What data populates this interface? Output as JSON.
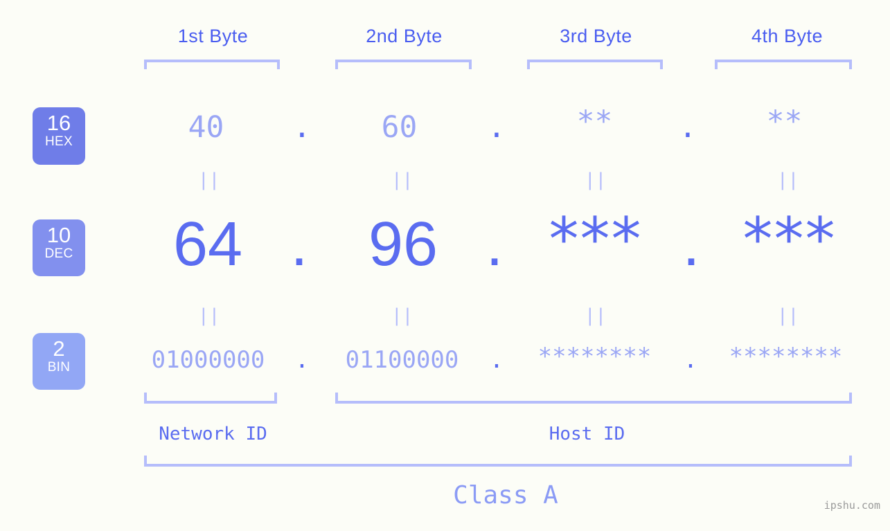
{
  "background_color": "#fcfdf7",
  "accent_colors": {
    "strong_blue": "#5a6cf0",
    "header_blue": "#4a5df0",
    "light_blue": "#9aa6f5",
    "bracket_blue": "#b5bdfb",
    "badge_hex": "#6f7de8",
    "badge_dec": "#8290ee",
    "badge_bin": "#92a7f5",
    "class_label": "#8b9bf5",
    "watermark": "#9a9a9a"
  },
  "byte_headers": [
    {
      "label": "1st Byte"
    },
    {
      "label": "2nd Byte"
    },
    {
      "label": "3rd Byte"
    },
    {
      "label": "4th Byte"
    }
  ],
  "base_badges": [
    {
      "number": "16",
      "name": "HEX"
    },
    {
      "number": "10",
      "name": "DEC"
    },
    {
      "number": "2",
      "name": "BIN"
    }
  ],
  "rows": {
    "hex": {
      "base": "16",
      "values": [
        "40",
        "60",
        "**",
        "**"
      ],
      "separator": "."
    },
    "dec": {
      "base": "10",
      "values": [
        "64",
        "96",
        "***",
        "***"
      ],
      "separator": "."
    },
    "bin": {
      "base": "2",
      "values": [
        "01000000",
        "01100000",
        "********",
        "********"
      ],
      "separator": "."
    }
  },
  "equals_marks": {
    "glyph": "||",
    "count_per_row": 4,
    "rows": 2
  },
  "id_labels": [
    {
      "label": "Network ID",
      "spans": "1st Byte"
    },
    {
      "label": "Host ID",
      "spans": "2nd-4th Byte"
    }
  ],
  "class_label": "Class A",
  "watermark": "ipshu.com"
}
